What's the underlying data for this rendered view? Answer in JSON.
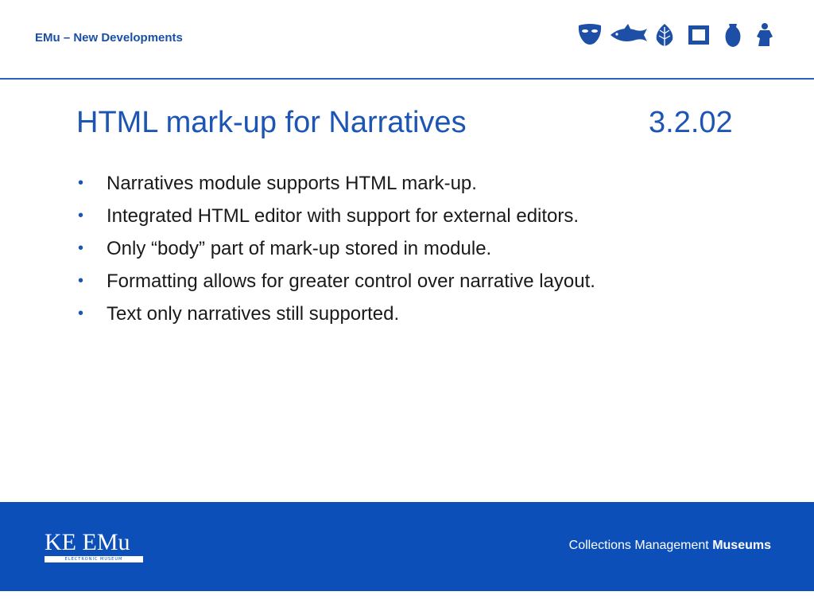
{
  "header": {
    "title": "EMu – New Developments",
    "icons": [
      "mask-icon",
      "fish-icon",
      "leaf-icon",
      "frame-icon",
      "vase-icon",
      "statue-icon"
    ],
    "accent_color": "#1c55b4"
  },
  "slide": {
    "title": "HTML mark-up for Narratives",
    "number": "3.2.02",
    "bullets": [
      "Narratives module supports HTML mark-up.",
      "Integrated HTML editor with support for external editors.",
      "Only “body” part of mark-up stored in module.",
      "Formatting allows for greater control over narrative layout.",
      "Text only narratives still supported."
    ],
    "bullet_symbol": "•"
  },
  "footer": {
    "logo_text": "KE EMu",
    "logo_subtext": "ELECTRONIC MUSEUM",
    "tagline_regular": "Collections Management",
    "tagline_bold": "Museums",
    "background_color": "#0d4fb8"
  }
}
